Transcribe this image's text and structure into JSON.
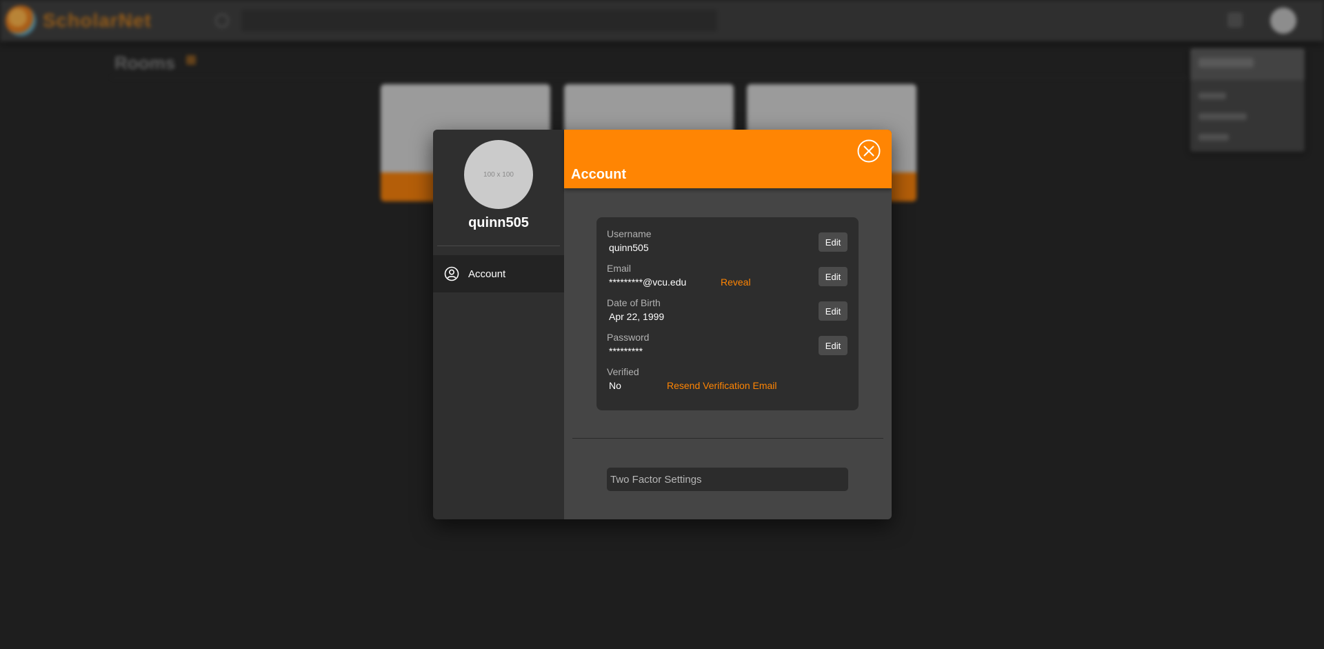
{
  "background": {
    "logo_text_a": "ScholarNet",
    "logo_text_b": "",
    "rooms_title": "Rooms",
    "menu_header": "Username"
  },
  "colors": {
    "accent": "#ff8503",
    "modal_sidebar": "#2f2f2f",
    "modal_main": "#454545",
    "card": "#2d2d2d"
  },
  "modal": {
    "avatar_placeholder": "100 x 100",
    "username": "quinn505",
    "nav": [
      {
        "label": "Account",
        "icon": "user-circle-icon",
        "active": true
      }
    ],
    "header_title": "Account",
    "close_icon": "close-circle-icon",
    "fields": {
      "username": {
        "label": "Username",
        "value": "quinn505",
        "edit_label": "Edit"
      },
      "email": {
        "label": "Email",
        "value": "*********@vcu.edu",
        "reveal_label": "Reveal",
        "edit_label": "Edit"
      },
      "dob": {
        "label": "Date of Birth",
        "value": "Apr 22, 1999",
        "edit_label": "Edit"
      },
      "password": {
        "label": "Password",
        "value": "*********",
        "edit_label": "Edit"
      },
      "verified": {
        "label": "Verified",
        "value": "No",
        "resend_label": "Resend Verification Email"
      }
    },
    "two_factor_label": "Two Factor Settings"
  }
}
